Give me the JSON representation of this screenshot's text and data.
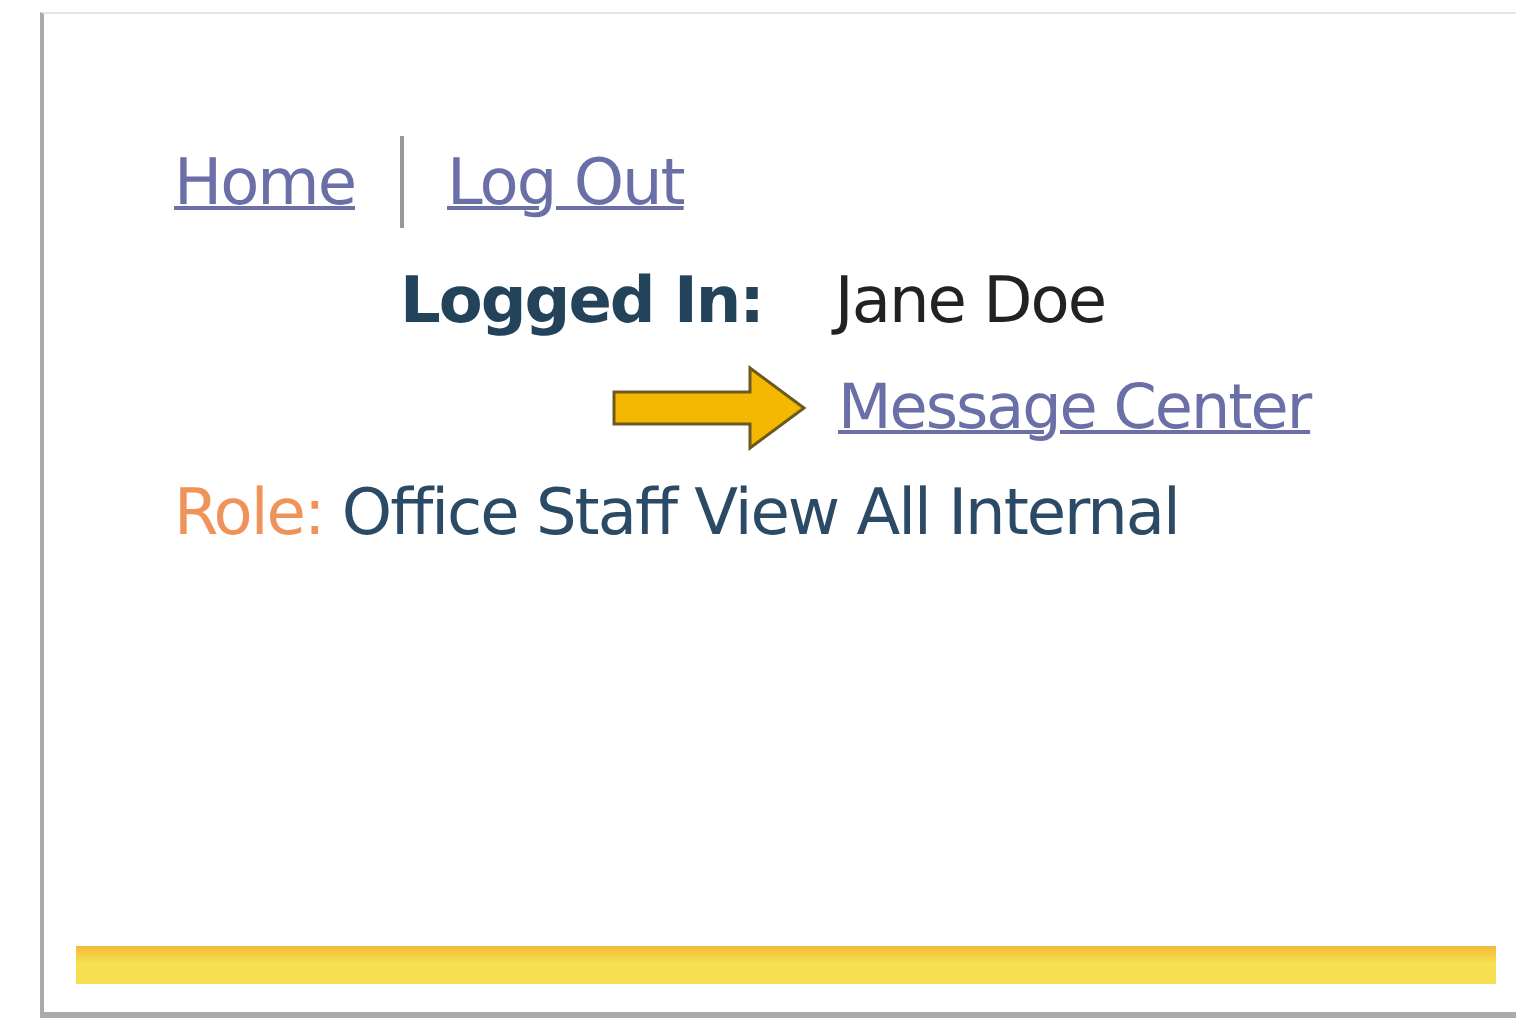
{
  "nav_links": [
    "Home",
    "Log Out"
  ],
  "logged_in": {
    "label": "Logged In:",
    "user": "Jane Doe"
  },
  "message_center": {
    "label": "Message Center"
  },
  "role": {
    "label": "Role:",
    "value": "Office Staff View All Internal"
  }
}
